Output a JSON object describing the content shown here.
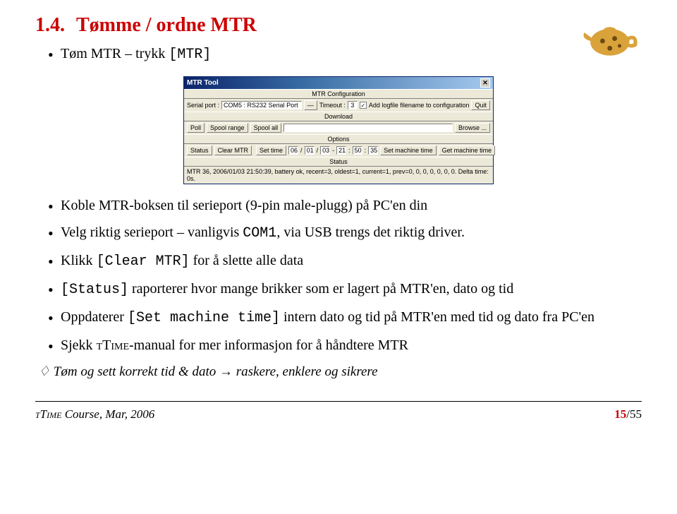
{
  "section": {
    "number": "1.4.",
    "title": "Tømme / ordne MTR"
  },
  "top_bullet": {
    "pre": "Tøm MTR – trykk ",
    "code": "[MTR]"
  },
  "mtrtool": {
    "title": "MTR Tool",
    "configHeader": "MTR Configuration",
    "serialPortLabel": "Serial port :",
    "serialPortValue": "COM5 : RS232 Serial Port",
    "timeoutLabel": "Timeout :",
    "timeoutValue": "3",
    "addLogLabel": "Add logfile filename to configuration",
    "quit": "Quit",
    "downloadHeader": "Download",
    "poll": "Poll",
    "spoolRange": "Spool range",
    "spoolAll": "Spool all",
    "browse": "Browse ...",
    "optionsHeader": "Options",
    "status": "Status",
    "clearMtr": "Clear MTR",
    "setTime": "Set time",
    "d1": "06",
    "d2": "01",
    "d3": "03",
    "t1": "21",
    "t2": "50",
    "t3": "35",
    "setMachine": "Set machine time",
    "getMachine": "Get machine time",
    "statusHeader": "Status",
    "statusLine": "MTR 36, 2006/01/03 21:50:39, battery ok, recent=3, oldest=1, current=1, prev=0, 0, 0, 0, 0, 0, 0. Delta time: 0s."
  },
  "bullets": {
    "b1": "Koble MTR-boksen til serieport (9-pin male-plugg) på PC'en din",
    "b2_pre": "Velg riktig serieport – vanligvis ",
    "b2_code": "COM1",
    "b2_post": ", via USB trengs det riktig driver.",
    "b3_pre": "Klikk ",
    "b3_code": "[Clear MTR]",
    "b3_post": " for å slette alle data",
    "b4_code": "[Status]",
    "b4_post": " raporterer hvor mange brikker som er lagert på MTR'en, dato og tid",
    "b5_pre": "Oppdaterer ",
    "b5_code": "[Set machine time]",
    "b5_post": " intern dato og tid på MTR'en med tid og dato fra PC'en",
    "b6_pre": "Sjekk ",
    "b6_sc": "tTime",
    "b6_post": "-manual for mer informasjon for å håndtere MTR"
  },
  "diamond": "♢ Tøm og sett korrekt tid & dato → raskere, enklere og sikrere",
  "footer": {
    "left_sc": "tTime",
    "left_rest": " Course, Mar, 2006",
    "page_cur": "15",
    "page_total": "/55"
  }
}
